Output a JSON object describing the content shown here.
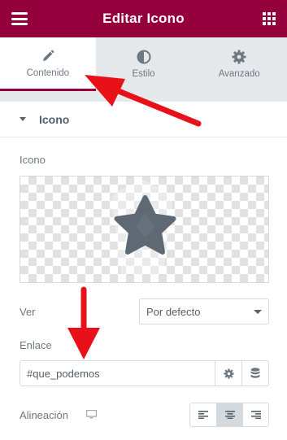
{
  "header": {
    "title": "Editar Icono"
  },
  "tabs": [
    {
      "label": "Contenido",
      "icon": "pencil-icon",
      "active": true
    },
    {
      "label": "Estilo",
      "icon": "contrast-icon",
      "active": false
    },
    {
      "label": "Avanzado",
      "icon": "gear-icon",
      "active": false
    }
  ],
  "section": {
    "title": "Icono"
  },
  "icon_field": {
    "label": "Icono",
    "selected_icon": "star-icon"
  },
  "view_field": {
    "label": "Ver",
    "selected": "Por defecto"
  },
  "link_field": {
    "label": "Enlace",
    "value": "#que_podemos"
  },
  "alignment_field": {
    "label": "Alineación",
    "selected": "center"
  },
  "colors": {
    "brand": "#93003c",
    "annotation_arrow": "#e8111a",
    "star": "#5e6973"
  }
}
